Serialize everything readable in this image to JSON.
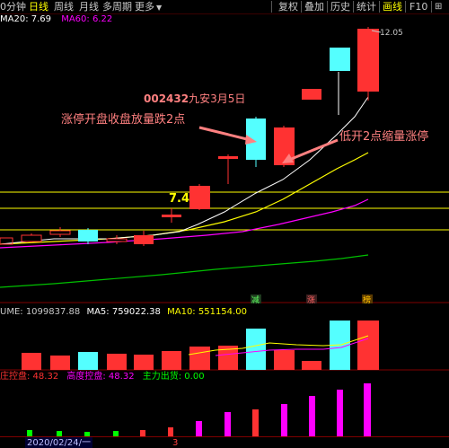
{
  "toolbar": {
    "items": [
      "0分钟",
      "日线",
      "周线",
      "月线",
      "多周期",
      "更多",
      "复权",
      "叠加",
      "历史",
      "统计",
      "画线",
      "F10"
    ],
    "active": "日线",
    "dropdown_icon": "triangle-down"
  },
  "ma_info": {
    "ma20": "MA20: 7.69",
    "ma60": "MA60: 6.22"
  },
  "price_chart": {
    "high_label": "12.05",
    "level_label": "7.4",
    "title_code": "002432",
    "title_rest": "九安3月5日",
    "annotation_left": "涨停开盘收盘放量跌2点",
    "annotation_right": "低开2点缩量涨停",
    "markers": [
      "减",
      "涨",
      "榜"
    ]
  },
  "volume_info": {
    "volume": "UME: 1099837.88",
    "ma5": "MA5: 759022.38",
    "ma10": "MA10: 551154.00"
  },
  "indicator_info": {
    "a": "庄控盘: 48.32",
    "b": "高度控盘: 48.32",
    "c": "主力出货: 0.00"
  },
  "date_axis": {
    "date": "2020/02/24/一",
    "tick": "3"
  },
  "colors": {
    "up": "#ff3232",
    "down": "#54ffff",
    "ma_white": "#ffffff",
    "ma_yellow": "#ffff00",
    "ma_magenta": "#ff00ff",
    "ma_green": "#00c000"
  }
}
